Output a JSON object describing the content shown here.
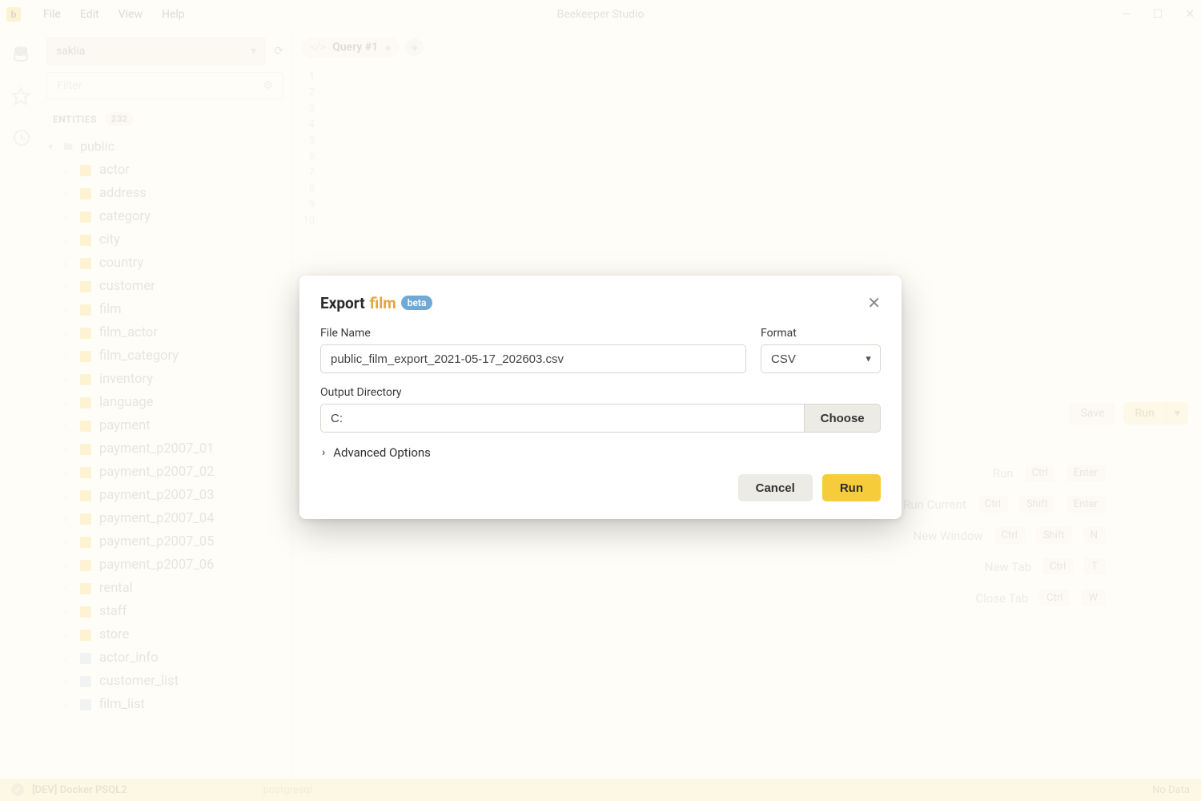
{
  "app": {
    "title": "Beekeeper Studio"
  },
  "menu": {
    "file": "File",
    "edit": "Edit",
    "view": "View",
    "help": "Help"
  },
  "sidebar": {
    "connection": "saklia",
    "filter_placeholder": "Filter",
    "entities_label": "ENTITIES",
    "entities_count": "232",
    "schema": "public",
    "tables": [
      "actor",
      "address",
      "category",
      "city",
      "country",
      "customer",
      "film",
      "film_actor",
      "film_category",
      "inventory",
      "language",
      "payment",
      "payment_p2007_01",
      "payment_p2007_02",
      "payment_p2007_03",
      "payment_p2007_04",
      "payment_p2007_05",
      "payment_p2007_06",
      "rental",
      "staff",
      "store"
    ],
    "views": [
      "actor_info",
      "customer_list",
      "film_list"
    ]
  },
  "tabs": {
    "active": "Query #1"
  },
  "editor": {
    "line_count": 10
  },
  "toolbar": {
    "save": "Save",
    "run": "Run"
  },
  "shortcuts": [
    {
      "label": "Run",
      "keys": [
        "Ctrl",
        "Enter"
      ]
    },
    {
      "label": "Run Current",
      "keys": [
        "Ctrl",
        "Shift",
        "Enter"
      ]
    },
    {
      "label": "New Window",
      "keys": [
        "Ctrl",
        "Shift",
        "N"
      ]
    },
    {
      "label": "New Tab",
      "keys": [
        "Ctrl",
        "T"
      ]
    },
    {
      "label": "Close Tab",
      "keys": [
        "Ctrl",
        "W"
      ]
    }
  ],
  "status": {
    "connection": "[DEV] Docker PSQL2",
    "db_type": "postgresql",
    "right": "No Data"
  },
  "modal": {
    "title_prefix": "Export",
    "title_highlight": "film",
    "beta": "beta",
    "file_name_label": "File Name",
    "file_name_value": "public_film_export_2021-05-17_202603.csv",
    "format_label": "Format",
    "format_value": "CSV",
    "output_dir_label": "Output Directory",
    "output_dir_value": "C:",
    "choose": "Choose",
    "advanced": "Advanced Options",
    "cancel": "Cancel",
    "run": "Run"
  }
}
